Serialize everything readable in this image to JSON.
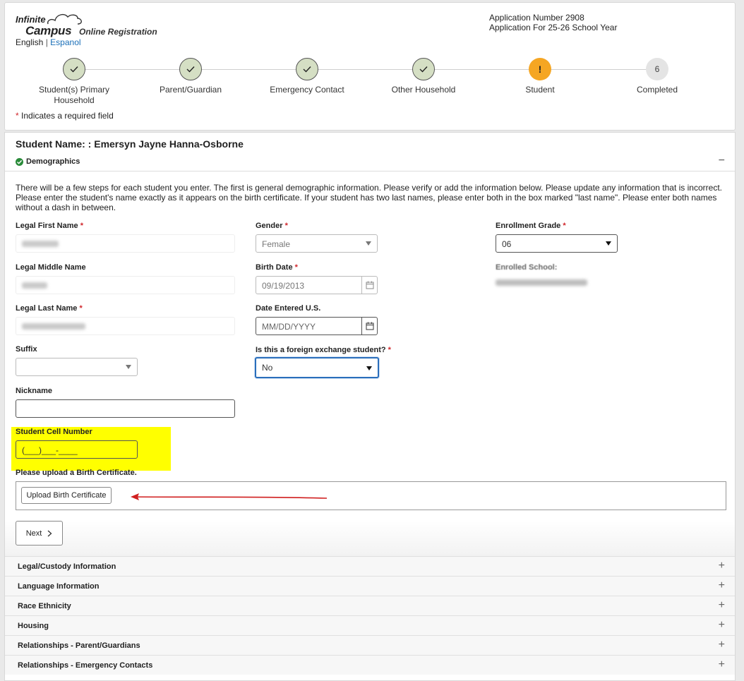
{
  "header": {
    "logo_top": "Infinite",
    "logo_main": "Campus",
    "logo_sub": "Online Registration",
    "lang_english": "English",
    "lang_sep": "|",
    "lang_espanol": "Espanol",
    "app_number": "Application Number 2908",
    "app_year": "Application For 25-26 School Year",
    "required_note": "Indicates a required field",
    "required_star": "*"
  },
  "steps": [
    {
      "label": "Student(s) Primary Household",
      "status": "done"
    },
    {
      "label": "Parent/Guardian",
      "status": "done"
    },
    {
      "label": "Emergency Contact",
      "status": "done"
    },
    {
      "label": "Other Household",
      "status": "done"
    },
    {
      "label": "Student",
      "status": "warning",
      "mark": "!"
    },
    {
      "label": "Completed",
      "status": "todo",
      "mark": "6"
    }
  ],
  "student": {
    "name": "Student Name: : Emersyn Jayne Hanna-Osborne",
    "section": "Demographics",
    "collapse": "−",
    "intro": "There will be a few steps for each student you enter. The first is general demographic information. Please verify or add the information below. Please update any information that is incorrect. Please enter the student's name exactly as it appears on the birth certificate. If your student has two last names, please enter both in the box marked \"last name\". Please enter both names without a dash in between."
  },
  "fields": {
    "legal_first_name": "Legal First Name",
    "legal_middle_name": "Legal Middle Name",
    "legal_last_name": "Legal Last Name",
    "suffix": "Suffix",
    "nickname": "Nickname",
    "student_cell": "Student Cell Number",
    "student_cell_placeholder": "(___)___-____",
    "gender": "Gender",
    "gender_value": "Female",
    "birth_date": "Birth Date",
    "birth_date_value": "09/19/2013",
    "date_entered": "Date Entered U.S.",
    "date_entered_placeholder": "MM/DD/YYYY",
    "exchange": "Is this a foreign exchange student?",
    "exchange_value": "No",
    "enrollment_grade": "Enrollment Grade",
    "enrollment_grade_value": "06",
    "enrolled_school": "Enrolled School:"
  },
  "upload": {
    "prompt": "Please upload a Birth Certificate.",
    "button": "Upload Birth Certificate"
  },
  "next_button": "Next",
  "accordion": [
    "Legal/Custody Information",
    "Language Information",
    "Race Ethnicity",
    "Housing",
    "Relationships - Parent/Guardians",
    "Relationships - Emergency Contacts"
  ],
  "accordion_icon": "+",
  "colors": {
    "link": "#1a6fb8",
    "required": "#d0262b",
    "step_done": "#d5dfc4",
    "step_warning": "#f5a623",
    "highlight": "#ffff00",
    "annotation_arrow": "#d01f1f",
    "focus": "#2a6ebb"
  }
}
